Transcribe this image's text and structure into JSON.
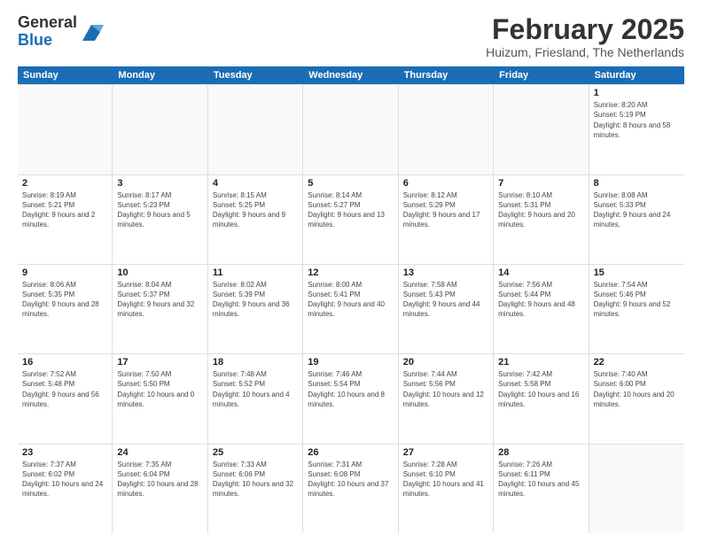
{
  "header": {
    "logo_general": "General",
    "logo_blue": "Blue",
    "month_title": "February 2025",
    "location": "Huizum, Friesland, The Netherlands"
  },
  "days_of_week": [
    "Sunday",
    "Monday",
    "Tuesday",
    "Wednesday",
    "Thursday",
    "Friday",
    "Saturday"
  ],
  "weeks": [
    [
      {
        "day": "",
        "info": ""
      },
      {
        "day": "",
        "info": ""
      },
      {
        "day": "",
        "info": ""
      },
      {
        "day": "",
        "info": ""
      },
      {
        "day": "",
        "info": ""
      },
      {
        "day": "",
        "info": ""
      },
      {
        "day": "1",
        "info": "Sunrise: 8:20 AM\nSunset: 5:19 PM\nDaylight: 8 hours and 58 minutes."
      }
    ],
    [
      {
        "day": "2",
        "info": "Sunrise: 8:19 AM\nSunset: 5:21 PM\nDaylight: 9 hours and 2 minutes."
      },
      {
        "day": "3",
        "info": "Sunrise: 8:17 AM\nSunset: 5:23 PM\nDaylight: 9 hours and 5 minutes."
      },
      {
        "day": "4",
        "info": "Sunrise: 8:15 AM\nSunset: 5:25 PM\nDaylight: 9 hours and 9 minutes."
      },
      {
        "day": "5",
        "info": "Sunrise: 8:14 AM\nSunset: 5:27 PM\nDaylight: 9 hours and 13 minutes."
      },
      {
        "day": "6",
        "info": "Sunrise: 8:12 AM\nSunset: 5:29 PM\nDaylight: 9 hours and 17 minutes."
      },
      {
        "day": "7",
        "info": "Sunrise: 8:10 AM\nSunset: 5:31 PM\nDaylight: 9 hours and 20 minutes."
      },
      {
        "day": "8",
        "info": "Sunrise: 8:08 AM\nSunset: 5:33 PM\nDaylight: 9 hours and 24 minutes."
      }
    ],
    [
      {
        "day": "9",
        "info": "Sunrise: 8:06 AM\nSunset: 5:35 PM\nDaylight: 9 hours and 28 minutes."
      },
      {
        "day": "10",
        "info": "Sunrise: 8:04 AM\nSunset: 5:37 PM\nDaylight: 9 hours and 32 minutes."
      },
      {
        "day": "11",
        "info": "Sunrise: 8:02 AM\nSunset: 5:39 PM\nDaylight: 9 hours and 36 minutes."
      },
      {
        "day": "12",
        "info": "Sunrise: 8:00 AM\nSunset: 5:41 PM\nDaylight: 9 hours and 40 minutes."
      },
      {
        "day": "13",
        "info": "Sunrise: 7:58 AM\nSunset: 5:43 PM\nDaylight: 9 hours and 44 minutes."
      },
      {
        "day": "14",
        "info": "Sunrise: 7:56 AM\nSunset: 5:44 PM\nDaylight: 9 hours and 48 minutes."
      },
      {
        "day": "15",
        "info": "Sunrise: 7:54 AM\nSunset: 5:46 PM\nDaylight: 9 hours and 52 minutes."
      }
    ],
    [
      {
        "day": "16",
        "info": "Sunrise: 7:52 AM\nSunset: 5:48 PM\nDaylight: 9 hours and 56 minutes."
      },
      {
        "day": "17",
        "info": "Sunrise: 7:50 AM\nSunset: 5:50 PM\nDaylight: 10 hours and 0 minutes."
      },
      {
        "day": "18",
        "info": "Sunrise: 7:48 AM\nSunset: 5:52 PM\nDaylight: 10 hours and 4 minutes."
      },
      {
        "day": "19",
        "info": "Sunrise: 7:46 AM\nSunset: 5:54 PM\nDaylight: 10 hours and 8 minutes."
      },
      {
        "day": "20",
        "info": "Sunrise: 7:44 AM\nSunset: 5:56 PM\nDaylight: 10 hours and 12 minutes."
      },
      {
        "day": "21",
        "info": "Sunrise: 7:42 AM\nSunset: 5:58 PM\nDaylight: 10 hours and 16 minutes."
      },
      {
        "day": "22",
        "info": "Sunrise: 7:40 AM\nSunset: 6:00 PM\nDaylight: 10 hours and 20 minutes."
      }
    ],
    [
      {
        "day": "23",
        "info": "Sunrise: 7:37 AM\nSunset: 6:02 PM\nDaylight: 10 hours and 24 minutes."
      },
      {
        "day": "24",
        "info": "Sunrise: 7:35 AM\nSunset: 6:04 PM\nDaylight: 10 hours and 28 minutes."
      },
      {
        "day": "25",
        "info": "Sunrise: 7:33 AM\nSunset: 6:06 PM\nDaylight: 10 hours and 32 minutes."
      },
      {
        "day": "26",
        "info": "Sunrise: 7:31 AM\nSunset: 6:08 PM\nDaylight: 10 hours and 37 minutes."
      },
      {
        "day": "27",
        "info": "Sunrise: 7:28 AM\nSunset: 6:10 PM\nDaylight: 10 hours and 41 minutes."
      },
      {
        "day": "28",
        "info": "Sunrise: 7:26 AM\nSunset: 6:11 PM\nDaylight: 10 hours and 45 minutes."
      },
      {
        "day": "",
        "info": ""
      }
    ]
  ]
}
